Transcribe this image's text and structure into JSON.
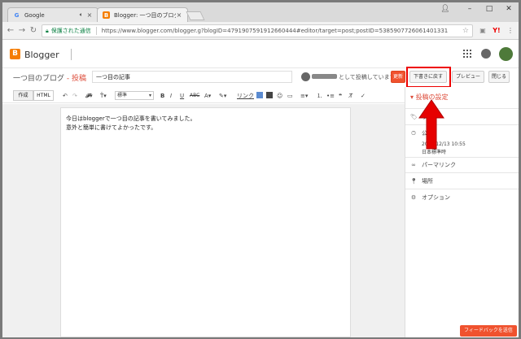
{
  "browser": {
    "tabs": [
      {
        "title": "Google",
        "favicon": "G"
      },
      {
        "title": "Blogger: 一つ目のブログ",
        "favicon": "B"
      }
    ],
    "address": {
      "secure_label": "保護された通信",
      "url": "https://www.blogger.com/blogger.g?blogID=4791907591912660444#editor/target=post;postID=5385907726061401331"
    }
  },
  "blogger": {
    "brand": "Blogger",
    "blog_name": "一つ目のブログ",
    "separator": " - ",
    "post_label": "投稿",
    "post_title": "一つ目の記事",
    "posting_as": "として投稿しています",
    "buttons": {
      "update": "更新",
      "revert_to_draft": "下書きに戻す",
      "preview": "プレビュー",
      "close": "閉じる"
    },
    "modes": {
      "compose": "作成",
      "html": "HTML"
    },
    "toolbar": {
      "format": "標準",
      "link": "リンク",
      "undo_icon": "undo-icon",
      "redo_icon": "redo-icon"
    },
    "editor_lines": [
      "今日はbloggerで一つ目の記事を書いてみました。",
      "意外と簡単に書けてよかったです。"
    ],
    "settings": {
      "title": "投稿の設定",
      "labels": "ラ",
      "schedule": "公",
      "schedule_datetime": "2017/12/13 10:55",
      "timezone": "日本標準時",
      "permalink": "パーマリンク",
      "location": "場所",
      "options": "オプション"
    },
    "feedback": "フィードバックを送信"
  },
  "colors": {
    "blogger_orange": "#f57d00",
    "accent_red": "#dd4b39",
    "update_button": "#f0522e",
    "highlight": "#e00000"
  }
}
